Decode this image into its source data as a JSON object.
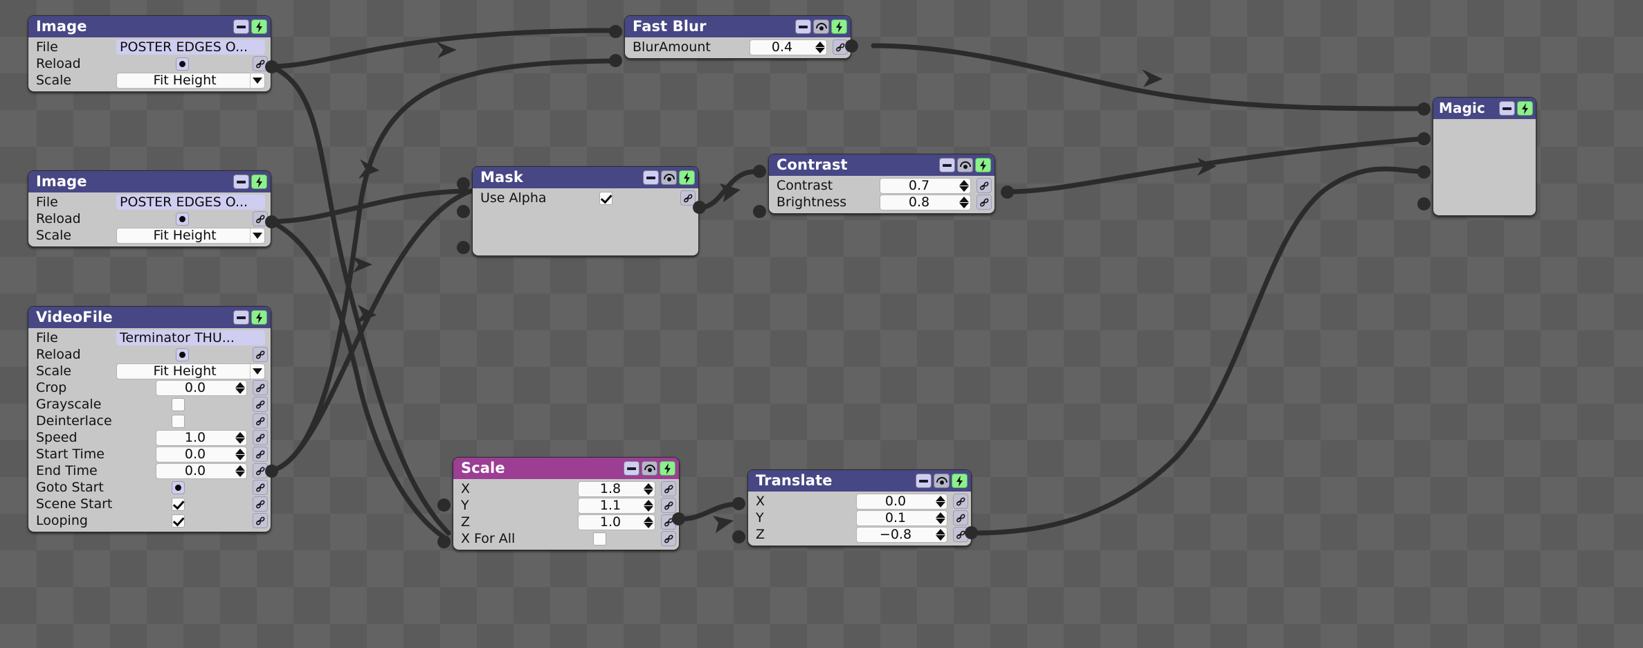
{
  "app": {
    "canvas_background": "#5b5b5b",
    "checker_alt": "#636363",
    "title_blue": "#474785",
    "title_magenta": "#9c3e94",
    "node_body": "#c7c7c7",
    "accent_green": "#8cf08c",
    "field_lavender": "#cfcdf0",
    "wire_color": "#2b2b2b"
  },
  "icons": {
    "minimize": "minimize-icon",
    "collapse": "collapse-icon",
    "bolt": "bolt-icon",
    "link": "link-icon",
    "dropdown": "chevron-down-icon",
    "spinner_up": "spinner-up-icon",
    "spinner_down": "spinner-down-icon"
  },
  "nodes": [
    {
      "id": "image1",
      "title": "Image",
      "title_color": "blue",
      "buttons": [
        "minimize",
        "bolt"
      ],
      "rows": [
        {
          "label": "File",
          "type": "text",
          "value": "POSTER EDGES O...",
          "link": false
        },
        {
          "label": "Reload",
          "type": "radio",
          "value": "",
          "link": true
        },
        {
          "label": "Scale",
          "type": "combo",
          "value": "Fit Height",
          "link": false
        }
      ]
    },
    {
      "id": "image2",
      "title": "Image",
      "title_color": "blue",
      "buttons": [
        "minimize",
        "bolt"
      ],
      "rows": [
        {
          "label": "File",
          "type": "text",
          "value": "POSTER EDGES O...",
          "link": false
        },
        {
          "label": "Reload",
          "type": "radio",
          "value": "",
          "link": true
        },
        {
          "label": "Scale",
          "type": "combo",
          "value": "Fit Height",
          "link": false
        }
      ]
    },
    {
      "id": "videofile",
      "title": "VideoFile",
      "title_color": "blue",
      "buttons": [
        "minimize",
        "bolt"
      ],
      "rows": [
        {
          "label": "File",
          "type": "text",
          "value": "Terminator THU...",
          "link": false
        },
        {
          "label": "Reload",
          "type": "radio",
          "value": "",
          "link": true
        },
        {
          "label": "Scale",
          "type": "combo",
          "value": "Fit Height",
          "link": false
        },
        {
          "label": "Crop",
          "type": "spin",
          "value": "0.0",
          "link": true
        },
        {
          "label": "Grayscale",
          "type": "check",
          "value": "off",
          "link": true
        },
        {
          "label": "Deinterlace",
          "type": "check",
          "value": "off",
          "link": true
        },
        {
          "label": "Speed",
          "type": "spin",
          "value": "1.0",
          "link": true
        },
        {
          "label": "Start Time",
          "type": "spin",
          "value": "0.0",
          "link": true
        },
        {
          "label": "End Time",
          "type": "spin",
          "value": "0.0",
          "link": true
        },
        {
          "label": "Goto Start",
          "type": "radio",
          "value": "",
          "link": true
        },
        {
          "label": "Scene Start",
          "type": "check",
          "value": "on",
          "link": true
        },
        {
          "label": "Looping",
          "type": "check",
          "value": "on",
          "link": true
        }
      ]
    },
    {
      "id": "fastblur",
      "title": "Fast Blur",
      "title_color": "blue",
      "buttons": [
        "minimize",
        "collapse",
        "bolt"
      ],
      "rows": [
        {
          "label": "BlurAmount",
          "type": "spin",
          "value": "0.4",
          "link": true
        }
      ]
    },
    {
      "id": "mask",
      "title": "Mask",
      "title_color": "blue",
      "buttons": [
        "minimize",
        "collapse",
        "bolt"
      ],
      "rows": [
        {
          "label": "Use Alpha",
          "type": "check",
          "value": "on",
          "link": true
        }
      ]
    },
    {
      "id": "contrast",
      "title": "Contrast",
      "title_color": "blue",
      "buttons": [
        "minimize",
        "collapse",
        "bolt"
      ],
      "rows": [
        {
          "label": "Contrast",
          "type": "spin",
          "value": "0.7",
          "link": true
        },
        {
          "label": "Brightness",
          "type": "spin",
          "value": "0.8",
          "link": true
        }
      ]
    },
    {
      "id": "scale",
      "title": "Scale",
      "title_color": "magenta",
      "buttons": [
        "minimize",
        "collapse",
        "bolt"
      ],
      "rows": [
        {
          "label": "X",
          "type": "spin",
          "value": "1.8",
          "link": true
        },
        {
          "label": "Y",
          "type": "spin",
          "value": "1.1",
          "link": true
        },
        {
          "label": "Z",
          "type": "spin",
          "value": "1.0",
          "link": true
        },
        {
          "label": "X For All",
          "type": "check",
          "value": "off",
          "link": true
        }
      ]
    },
    {
      "id": "translate",
      "title": "Translate",
      "title_color": "blue",
      "buttons": [
        "minimize",
        "collapse",
        "bolt"
      ],
      "rows": [
        {
          "label": "X",
          "type": "spin",
          "value": "0.0",
          "link": true
        },
        {
          "label": "Y",
          "type": "spin",
          "value": "0.1",
          "link": true
        },
        {
          "label": "Z",
          "type": "spin",
          "value": "−0.8",
          "link": true
        }
      ]
    },
    {
      "id": "magic",
      "title": "Magic",
      "title_color": "blue",
      "buttons": [
        "minimize",
        "bolt"
      ],
      "rows": []
    }
  ]
}
